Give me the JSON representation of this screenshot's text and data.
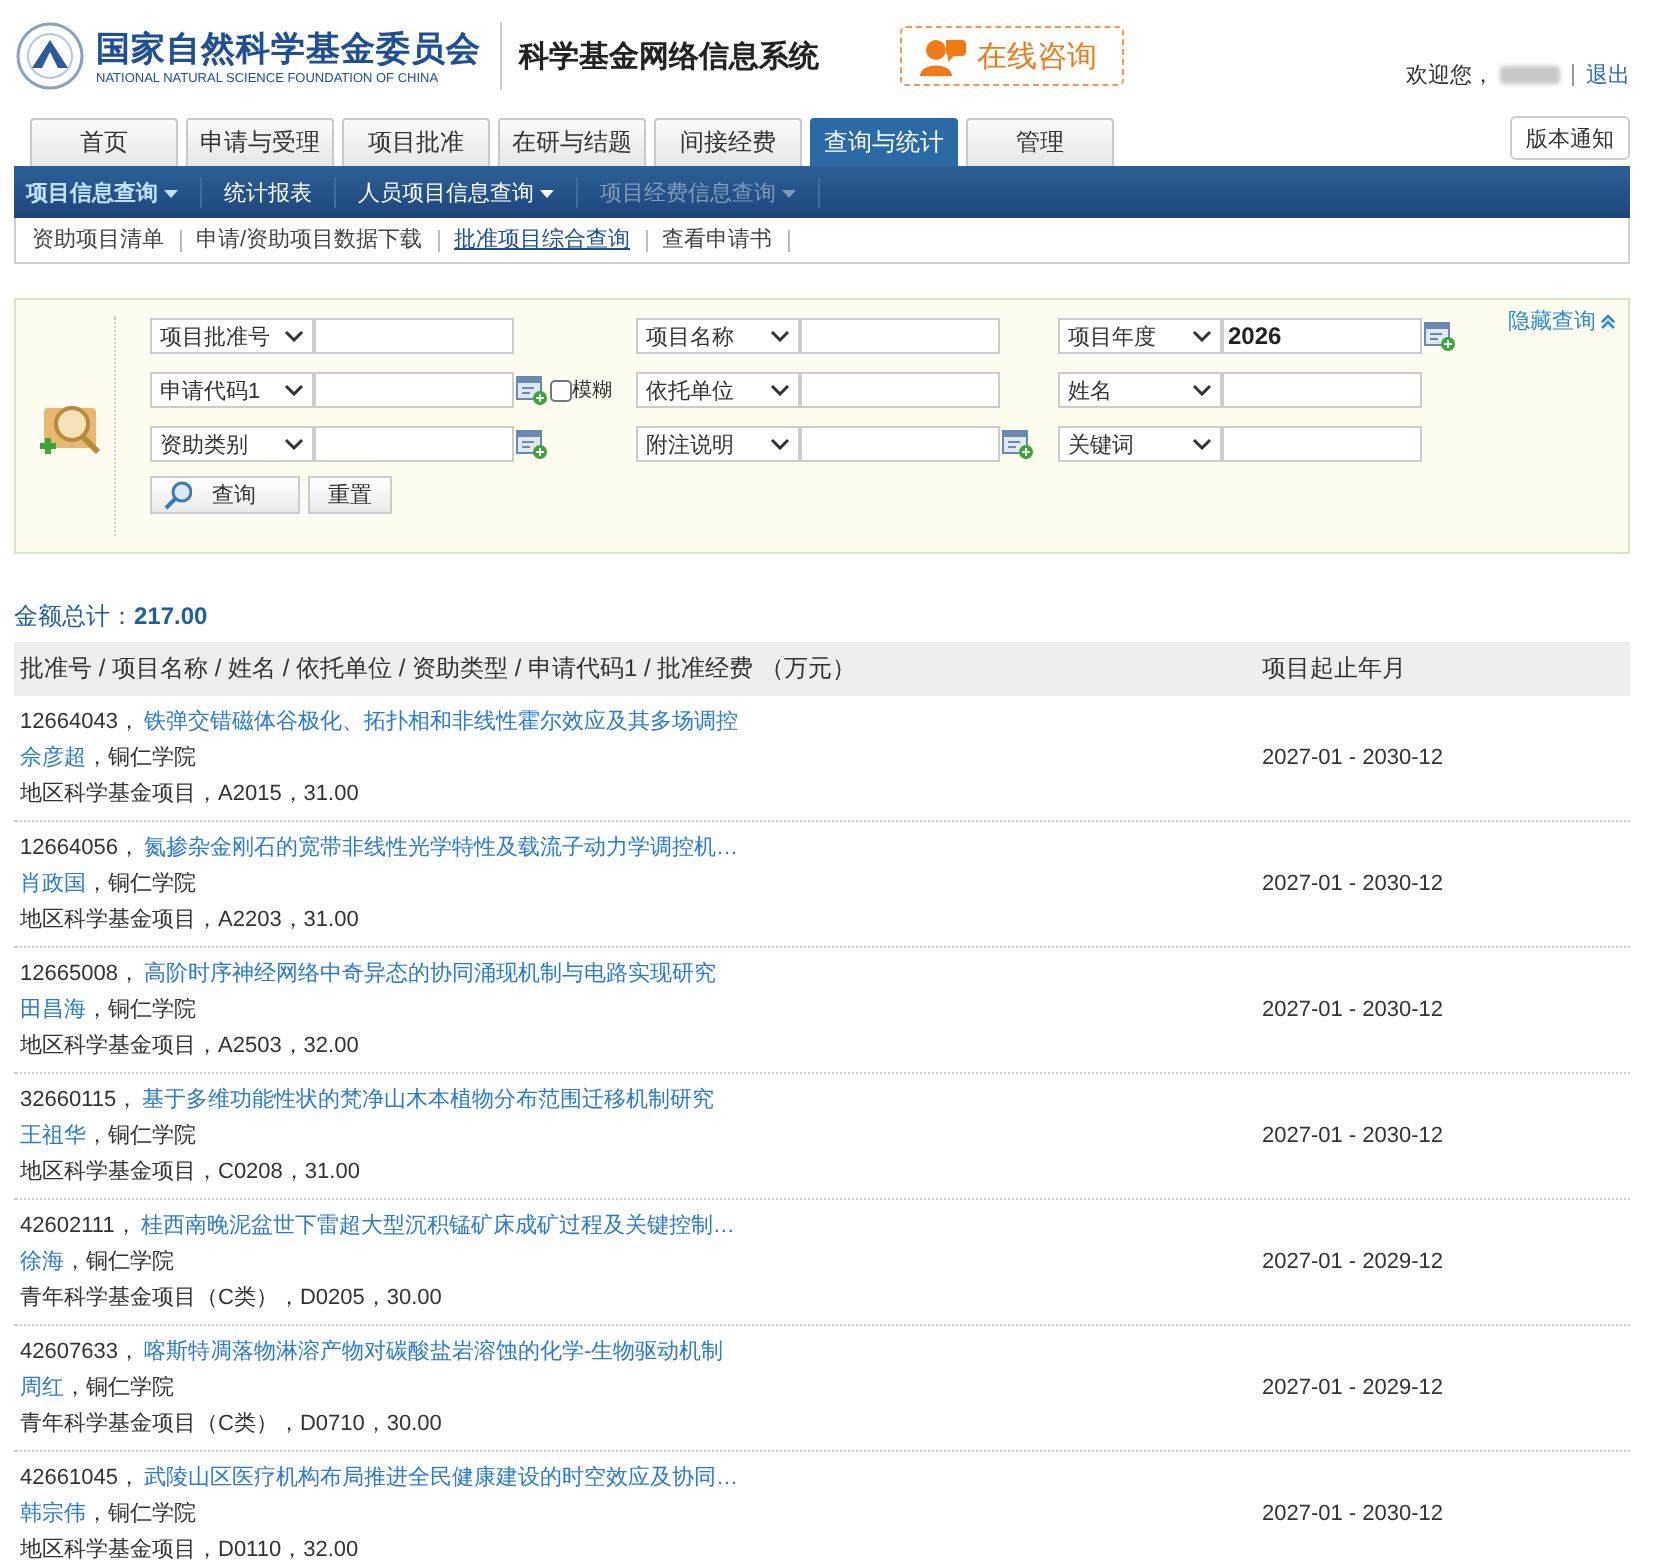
{
  "header": {
    "org_name_cn": "国家自然科学基金委员会",
    "org_name_en": "NATIONAL NATURAL SCIENCE FOUNDATION OF CHINA",
    "system_title": "科学基金网络信息系统",
    "consult_button": "在线咨询",
    "welcome": "欢迎您，",
    "logout": "退出"
  },
  "tabs": [
    {
      "label": "首页",
      "selected": false
    },
    {
      "label": "申请与受理",
      "selected": false
    },
    {
      "label": "项目批准",
      "selected": false
    },
    {
      "label": "在研与结题",
      "selected": false
    },
    {
      "label": "间接经费",
      "selected": false
    },
    {
      "label": "查询与统计",
      "selected": true
    },
    {
      "label": "管理",
      "selected": false
    }
  ],
  "version_notice": "版本通知",
  "nav": [
    {
      "label": "项目信息查询",
      "selected": true,
      "dropdown": true,
      "disabled": false
    },
    {
      "label": "统计报表",
      "selected": false,
      "disabled": false
    },
    {
      "label": "人员项目信息查询",
      "selected": false,
      "dropdown": true,
      "disabled": false
    },
    {
      "label": "项目经费信息查询",
      "selected": false,
      "dropdown": true,
      "disabled": true
    }
  ],
  "subnav": [
    {
      "label": "资助项目清单",
      "selected": false
    },
    {
      "label": "申请/资助项目数据下载",
      "selected": false
    },
    {
      "label": "批准项目综合查询",
      "selected": true
    },
    {
      "label": "查看申请书",
      "selected": false
    }
  ],
  "search": {
    "hide_link": "隐藏查询",
    "fields": [
      [
        {
          "select": "项目批准号"
        },
        {
          "select": "项目名称"
        },
        {
          "select": "项目年度",
          "value": "2026",
          "picker": true
        }
      ],
      [
        {
          "select": "申请代码1",
          "picker": true,
          "fuzzy": {
            "label": "模糊",
            "checked": false
          }
        },
        {
          "select": "依托单位"
        },
        {
          "select": "姓名"
        }
      ],
      [
        {
          "select": "资助类别",
          "picker": true
        },
        {
          "select": "附注说明",
          "picker": true
        },
        {
          "select": "关键词"
        }
      ]
    ],
    "search_button": "查询",
    "reset_button": "重置"
  },
  "total": {
    "label": "金额总计：",
    "value": "217.00"
  },
  "table": {
    "columns": [
      "批准号 / 项目名称 / 姓名 / 依托单位 / 资助类型 / 申请代码1 / 批准经费 （万元）",
      "项目起止年月"
    ],
    "rows": [
      {
        "number": "12664043，",
        "title": "铁弹交错磁体谷极化、拓扑相和非线性霍尔效应及其多场调控",
        "person": "佘彦超",
        "unit": "，铜仁学院",
        "detail": "地区科学基金项目，A2015，31.00",
        "period": "2027-01 - 2030-12"
      },
      {
        "number": "12664056，",
        "title": "氮掺杂金刚石的宽带非线性光学特性及载流子动力学调控机…",
        "person": "肖政国",
        "unit": "，铜仁学院",
        "detail": "地区科学基金项目，A2203，31.00",
        "period": "2027-01 - 2030-12"
      },
      {
        "number": "12665008，",
        "title": "高阶时序神经网络中奇异态的协同涌现机制与电路实现研究",
        "person": "田昌海",
        "unit": "，铜仁学院",
        "detail": "地区科学基金项目，A2503，32.00",
        "period": "2027-01 - 2030-12"
      },
      {
        "number": "32660115，",
        "title": "基于多维功能性状的梵净山木本植物分布范围迁移机制研究",
        "person": "王祖华",
        "unit": "，铜仁学院",
        "detail": "地区科学基金项目，C0208，31.00",
        "period": "2027-01 - 2030-12"
      },
      {
        "number": "42602111，",
        "title": "桂西南晚泥盆世下雷超大型沉积锰矿床成矿过程及关键控制…",
        "person": "徐海",
        "unit": "，铜仁学院",
        "detail": "青年科学基金项目（C类），D0205，30.00",
        "period": "2027-01 - 2029-12"
      },
      {
        "number": "42607633，",
        "title": "喀斯特凋落物淋溶产物对碳酸盐岩溶蚀的化学-生物驱动机制",
        "person": "周红",
        "unit": "，铜仁学院",
        "detail": "青年科学基金项目（C类），D0710，30.00",
        "period": "2027-01 - 2029-12"
      },
      {
        "number": "42661045，",
        "title": "武陵山区医疗机构布局推进全民健康建设的时空效应及协同…",
        "person": "韩宗伟",
        "unit": "，铜仁学院",
        "detail": "地区科学基金项目，D0110，32.00",
        "period": "2027-01 - 2030-12"
      }
    ]
  }
}
